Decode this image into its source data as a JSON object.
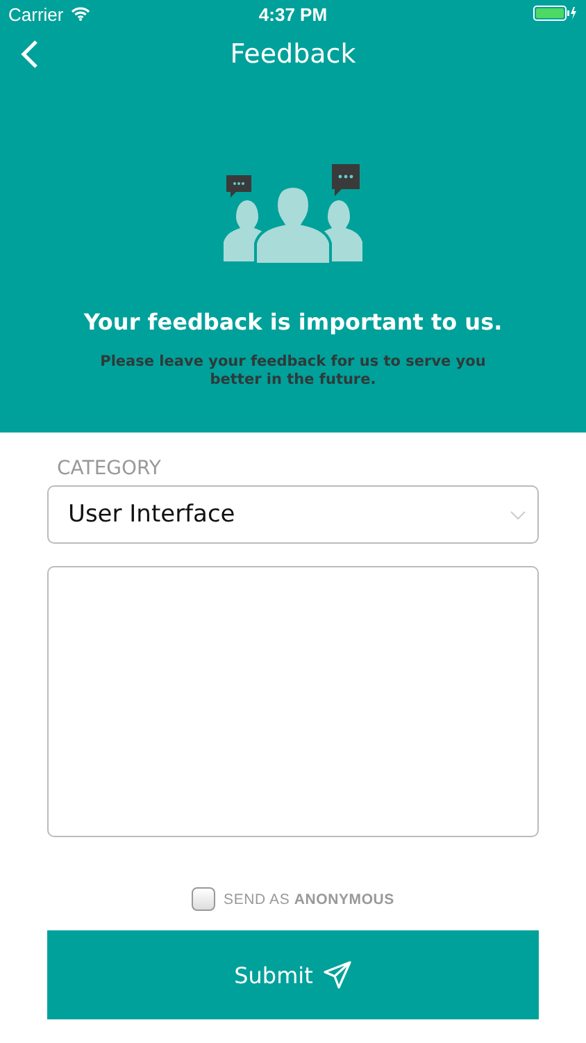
{
  "status_bar": {
    "carrier": "Carrier",
    "time": "4:37 PM"
  },
  "nav": {
    "title": "Feedback"
  },
  "header": {
    "title": "Your feedback is important to us.",
    "subtitle": "Please leave your feedback for us to serve you better in the future."
  },
  "form": {
    "category_label": "CATEGORY",
    "category_value": "User Interface",
    "anonymous": {
      "label": "SEND AS **ANONYMOUS**",
      "checked": false
    },
    "submit": "Submit"
  }
}
